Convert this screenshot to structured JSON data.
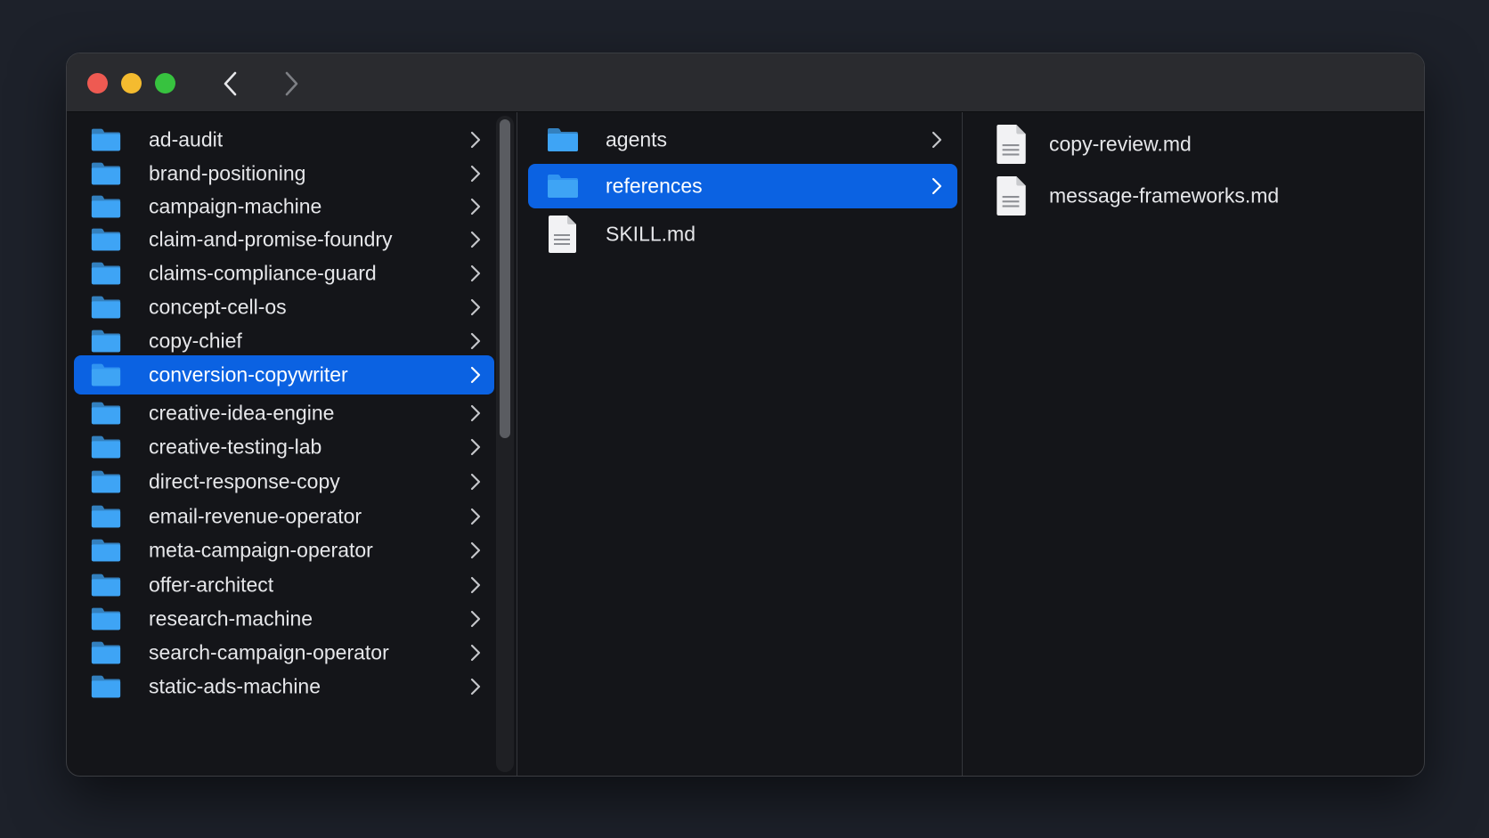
{
  "window": {
    "nav": {
      "back_icon": "chevron-left-icon",
      "forward_icon": "chevron-right-icon"
    }
  },
  "colors": {
    "selection": "#0b62e2",
    "folder": "#3ea4f5",
    "close": "#ee5a52",
    "minimize": "#f4bb2f",
    "zoom": "#37c23f"
  },
  "column1": {
    "items": [
      {
        "label": "ad-audit",
        "type": "folder",
        "selected": false
      },
      {
        "label": "brand-positioning",
        "type": "folder",
        "selected": false
      },
      {
        "label": "campaign-machine",
        "type": "folder",
        "selected": false
      },
      {
        "label": "claim-and-promise-foundry",
        "type": "folder",
        "selected": false
      },
      {
        "label": "claims-compliance-guard",
        "type": "folder",
        "selected": false
      },
      {
        "label": "concept-cell-os",
        "type": "folder",
        "selected": false
      },
      {
        "label": "copy-chief",
        "type": "folder",
        "selected": false
      },
      {
        "label": "conversion-copywriter",
        "type": "folder",
        "selected": true
      },
      {
        "label": "creative-idea-engine",
        "type": "folder",
        "selected": false
      },
      {
        "label": "creative-testing-lab",
        "type": "folder",
        "selected": false
      },
      {
        "label": "direct-response-copy",
        "type": "folder",
        "selected": false
      },
      {
        "label": "email-revenue-operator",
        "type": "folder",
        "selected": false
      },
      {
        "label": "meta-campaign-operator",
        "type": "folder",
        "selected": false
      },
      {
        "label": "offer-architect",
        "type": "folder",
        "selected": false
      },
      {
        "label": "research-machine",
        "type": "folder",
        "selected": false
      },
      {
        "label": "search-campaign-operator",
        "type": "folder",
        "selected": false
      },
      {
        "label": "static-ads-machine",
        "type": "folder",
        "selected": false
      }
    ]
  },
  "column2": {
    "items": [
      {
        "label": "agents",
        "type": "folder",
        "selected": false
      },
      {
        "label": "references",
        "type": "folder",
        "selected": true
      },
      {
        "label": "SKILL.md",
        "type": "file",
        "selected": false
      }
    ]
  },
  "column3": {
    "items": [
      {
        "label": "copy-review.md",
        "type": "file"
      },
      {
        "label": "message-frameworks.md",
        "type": "file"
      }
    ]
  }
}
